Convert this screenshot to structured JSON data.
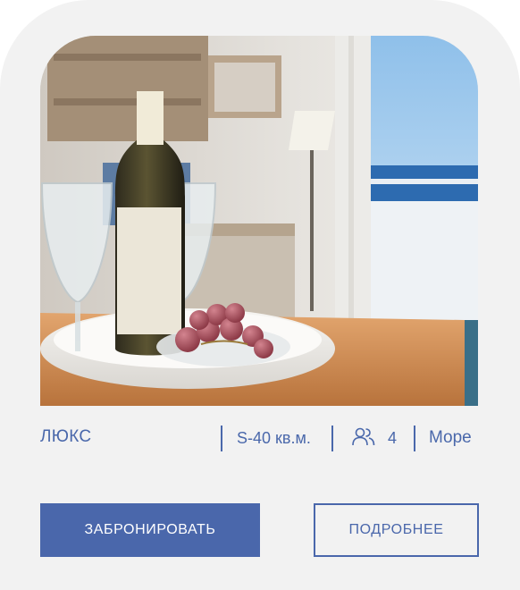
{
  "card": {
    "room_type": "ЛЮКС",
    "area": "S-40 кв.м.",
    "guests_icon": "people-icon",
    "guests": "4",
    "view": "Море",
    "photo_icon": "room-photo"
  },
  "actions": {
    "book_label": "ЗАБРОНИРОВАТЬ",
    "more_label": "ПОДРОБНЕЕ"
  },
  "colors": {
    "accent": "#4a67ab",
    "card_bg": "#f2f2f2",
    "button_text": "#ffffff"
  }
}
